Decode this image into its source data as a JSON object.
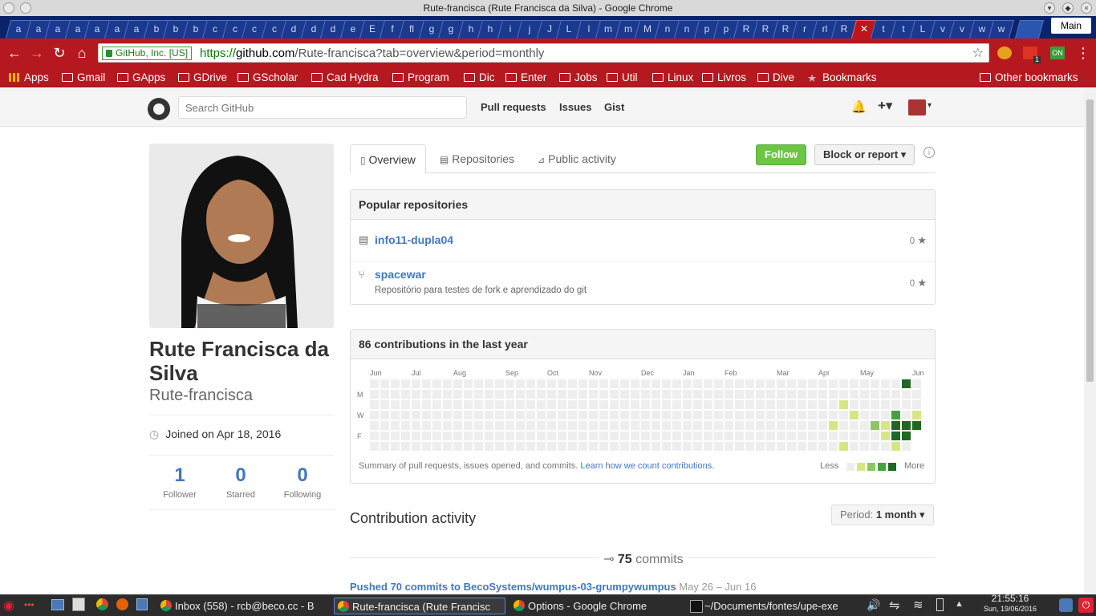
{
  "window": {
    "title": "Rute-francisca (Rute Francisca da Silva) - Google Chrome"
  },
  "tabstrip": {
    "tabs": [
      "a",
      "a",
      "a",
      "a",
      "a",
      "a",
      "a",
      "b",
      "b",
      "b",
      "c",
      "c",
      "c",
      "c",
      "d",
      "d",
      "d",
      "e",
      "E",
      "f",
      "fl",
      "g",
      "g",
      "h",
      "h",
      "i",
      "j",
      "J",
      "L",
      "l",
      "m",
      "m",
      "M",
      "n",
      "n",
      "p",
      "p",
      "R",
      "R",
      "R",
      "r",
      "rl",
      "R",
      "",
      "t",
      "t",
      "L",
      "v",
      "v",
      "w",
      "w"
    ],
    "active_index": 43,
    "profile_label": "Main"
  },
  "toolbar": {
    "ssl_label": "GitHub, Inc. [US]",
    "url_scheme": "https://",
    "url_host": "github.com",
    "url_path": "/Rute-francisca?tab=overview&period=monthly",
    "ext_badge_1": "1",
    "ext_badge_2": "ON"
  },
  "bookmarks": {
    "items": [
      "Apps",
      "Gmail",
      "GApps",
      "GDrive",
      "GScholar",
      "Cad Hydra",
      "Program",
      "Dic",
      "Enter",
      "Jobs",
      "Util",
      "Linux",
      "Livros",
      "Dive",
      "Bookmarks"
    ],
    "other": "Other bookmarks"
  },
  "gh_header": {
    "search_placeholder": "Search GitHub",
    "nav": [
      "Pull requests",
      "Issues",
      "Gist"
    ]
  },
  "profile": {
    "full_name": "Rute Francisca da Silva",
    "username": "Rute-francisca",
    "joined": "Joined on Apr 18, 2016",
    "stats": [
      {
        "value": "1",
        "label": "Follower"
      },
      {
        "value": "0",
        "label": "Starred"
      },
      {
        "value": "0",
        "label": "Following"
      }
    ]
  },
  "tabs": {
    "overview": "Overview",
    "repositories": "Repositories",
    "public_activity": "Public activity"
  },
  "actions": {
    "follow": "Follow",
    "block": "Block or report"
  },
  "popular": {
    "title": "Popular repositories",
    "repos": [
      {
        "name": "info11-dupla04",
        "desc": "",
        "stars": "0"
      },
      {
        "name": "spacewar",
        "desc": "Repositório para testes de fork e aprendizado do git",
        "stars": "0"
      }
    ]
  },
  "contributions": {
    "title": "86 contributions in the last year",
    "months": [
      "Jun",
      "Jul",
      "Aug",
      "Sep",
      "Oct",
      "Nov",
      "Dec",
      "Jan",
      "Feb",
      "Mar",
      "Apr",
      "May",
      "Jun"
    ],
    "day_labels": [
      "M",
      "W",
      "F"
    ],
    "summary": "Summary of pull requests, issues opened, and commits.",
    "learn_link": "Learn how we count contributions.",
    "legend_less": "Less",
    "legend_more": "More",
    "colors": [
      "#eeeeee",
      "#d6e685",
      "#8cc665",
      "#44a340",
      "#1e6823"
    ],
    "active_cells": [
      {
        "week": 45,
        "day": 2,
        "level": 1
      },
      {
        "week": 44,
        "day": 4,
        "level": 1
      },
      {
        "week": 45,
        "day": 6,
        "level": 1
      },
      {
        "week": 46,
        "day": 3,
        "level": 1
      },
      {
        "week": 48,
        "day": 4,
        "level": 2
      },
      {
        "week": 49,
        "day": 4,
        "level": 1
      },
      {
        "week": 49,
        "day": 5,
        "level": 1
      },
      {
        "week": 50,
        "day": 3,
        "level": 3
      },
      {
        "week": 50,
        "day": 4,
        "level": 4
      },
      {
        "week": 50,
        "day": 5,
        "level": 4
      },
      {
        "week": 50,
        "day": 6,
        "level": 1
      },
      {
        "week": 51,
        "day": 0,
        "level": 4
      },
      {
        "week": 51,
        "day": 4,
        "level": 4
      },
      {
        "week": 51,
        "day": 5,
        "level": 4
      },
      {
        "week": 52,
        "day": 3,
        "level": 1
      },
      {
        "week": 52,
        "day": 4,
        "level": 4
      }
    ]
  },
  "activity": {
    "title": "Contribution activity",
    "period_label": "Period:",
    "period_value": "1 month",
    "commits_count": "75",
    "commits_word": "commits",
    "pushed_text": "Pushed 70 commits to BecoSystems/wumpus-03-grumpywumpus",
    "pushed_range": "May 26 – Jun 16"
  },
  "taskbar": {
    "tasks": [
      "Inbox (558) - rcb@beco.cc - B",
      "Rute-francisca (Rute Francisc",
      "Options - Google Chrome",
      "~/Documents/fontes/upe-exe"
    ],
    "time": "21:55:16",
    "date": "Sun, 19/06/2016"
  }
}
